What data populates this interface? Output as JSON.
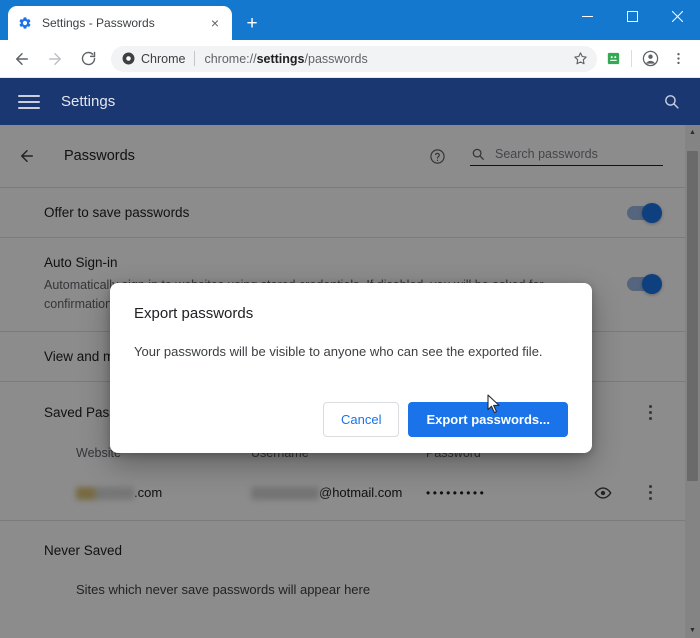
{
  "window": {
    "controls": {
      "minimize": "minimize-icon",
      "maximize": "maximize-icon",
      "close": "close-icon"
    }
  },
  "tabstrip": {
    "tab": {
      "favicon": "gear-icon",
      "title": "Settings - Passwords",
      "close_label": "×"
    },
    "new_tab_label": "+"
  },
  "toolbar": {
    "back_icon": "back-arrow-icon",
    "forward_icon": "forward-arrow-icon",
    "reload_icon": "reload-icon",
    "omnibox": {
      "chip_icon": "chrome-logo-icon",
      "chip_label": "Chrome",
      "url_prefix": "chrome://",
      "url_bold": "settings",
      "url_suffix": "/passwords",
      "bookmark_icon": "star-icon"
    },
    "extension_icon": "extension-icon",
    "profile_icon": "profile-avatar-icon",
    "menu_icon": "three-dot-menu-icon"
  },
  "settings_header": {
    "menu_icon": "hamburger-menu-icon",
    "title": "Settings",
    "search_icon": "search-icon"
  },
  "passwords_page": {
    "back_icon": "back-arrow-icon",
    "title": "Passwords",
    "help_icon": "help-circle-icon",
    "search": {
      "icon": "search-icon",
      "placeholder": "Search passwords",
      "value": ""
    },
    "settings_rows": [
      {
        "label": "Offer to save passwords",
        "sub": "",
        "toggle_state": "on"
      },
      {
        "label": "Auto Sign-in",
        "sub": "Automatically sign in to websites using stored credentials. If disabled, you will be asked for confirmation every time before signing in to a website.",
        "toggle_state": "on"
      }
    ],
    "account_link": "View and manage saved passwords in your Google Account",
    "saved_section": {
      "title": "Saved Passwords",
      "menu_icon": "three-dot-menu-icon",
      "columns": [
        "Website",
        "Username",
        "Password"
      ],
      "rows": [
        {
          "website_redacted": true,
          "website_suffix": ".com",
          "username_redacted": true,
          "username_suffix": "@hotmail.com",
          "password_mask": "•••••••••",
          "show_icon": "eye-icon",
          "menu_icon": "three-dot-menu-icon"
        }
      ]
    },
    "never_section": {
      "title": "Never Saved",
      "empty_text": "Sites which never save passwords will appear here"
    }
  },
  "dialog": {
    "title": "Export passwords",
    "message": "Your passwords will be visible to anyone who can see the exported file.",
    "cancel_label": "Cancel",
    "confirm_label": "Export passwords..."
  },
  "scrollbar": {
    "up_arrow": "▲",
    "down_arrow": "▼"
  },
  "colors": {
    "titlebar": "#1578cf",
    "settings_header": "#1a3771",
    "accent": "#1a73e8",
    "scrim": "rgba(0,0,0,0.45)"
  }
}
